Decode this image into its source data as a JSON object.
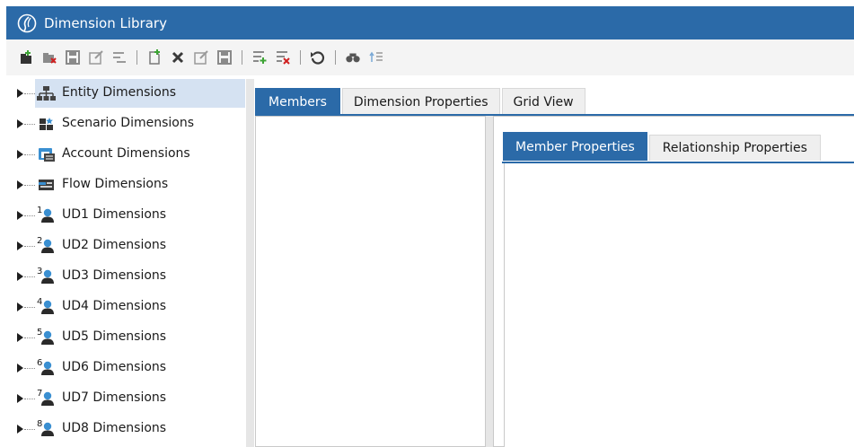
{
  "window": {
    "title": "Dimension Library"
  },
  "toolbar": {
    "icons": [
      "create-dimension-icon",
      "remove-dimension-icon",
      "save-dimension-icon",
      "edit-dimension-icon",
      "dimension-list-icon",
      "new-member-icon",
      "delete-member-icon",
      "edit-member-icon",
      "save-member-icon",
      "add-relationship-icon",
      "remove-relationship-icon",
      "refresh-icon",
      "search-icon",
      "sort-icon"
    ]
  },
  "tree": {
    "items": [
      {
        "label": "Entity Dimensions",
        "icon": "entity-icon",
        "selected": true
      },
      {
        "label": "Scenario Dimensions",
        "icon": "scenario-icon"
      },
      {
        "label": "Account Dimensions",
        "icon": "account-icon"
      },
      {
        "label": "Flow Dimensions",
        "icon": "flow-icon"
      },
      {
        "label": "UD1 Dimensions",
        "num": "1"
      },
      {
        "label": "UD2 Dimensions",
        "num": "2"
      },
      {
        "label": "UD3 Dimensions",
        "num": "3"
      },
      {
        "label": "UD4 Dimensions",
        "num": "4"
      },
      {
        "label": "UD5 Dimensions",
        "num": "5"
      },
      {
        "label": "UD6 Dimensions",
        "num": "6"
      },
      {
        "label": "UD7 Dimensions",
        "num": "7"
      },
      {
        "label": "UD8 Dimensions",
        "num": "8"
      }
    ]
  },
  "main_tabs": [
    {
      "label": "Members",
      "active": true
    },
    {
      "label": "Dimension Properties"
    },
    {
      "label": "Grid View"
    }
  ],
  "sub_tabs": [
    {
      "label": "Member Properties",
      "active": true
    },
    {
      "label": "Relationship Properties"
    }
  ],
  "colors": {
    "accent": "#2b6aa8",
    "selection": "#d5e2f2",
    "ud_blue": "#3a8fd1",
    "ud_dark": "#2a2a2a"
  }
}
